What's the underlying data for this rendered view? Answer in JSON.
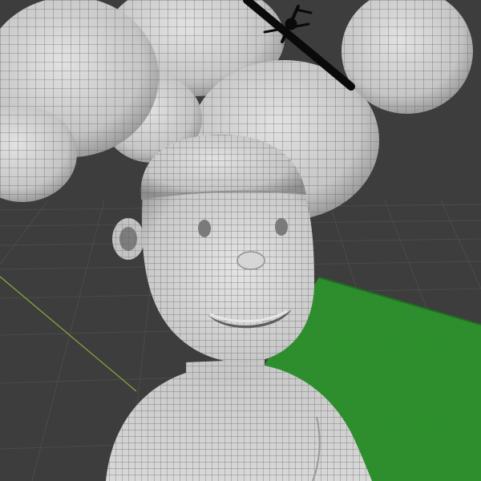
{
  "viewport": {
    "kind": "3d-viewport",
    "shading": "wireframe-over-solid",
    "background_color": "#3d3d3d",
    "grid_line_color": "#4a4a4a",
    "axis_line_color": "#84a63e",
    "ground_plane_color": "#2c8f2c",
    "mesh_color": "#cfcfcf",
    "mesh_shadow_color": "#8e8e8e",
    "wire_color": "#5a5a5a"
  },
  "objects": [
    {
      "id": "cloud-top-left",
      "type": "cloud-sphere"
    },
    {
      "id": "cloud-top-center",
      "type": "cloud-sphere"
    },
    {
      "id": "cloud-top-right",
      "type": "cloud-sphere"
    },
    {
      "id": "cloud-middle",
      "type": "cloud-sphere"
    },
    {
      "id": "airplane",
      "type": "airplane-silhouette"
    },
    {
      "id": "ground-plane",
      "type": "plane"
    },
    {
      "id": "character",
      "type": "character-mesh",
      "parts": [
        "head",
        "cap",
        "eyes",
        "nose",
        "mouth",
        "ear",
        "neck",
        "torso"
      ]
    }
  ]
}
